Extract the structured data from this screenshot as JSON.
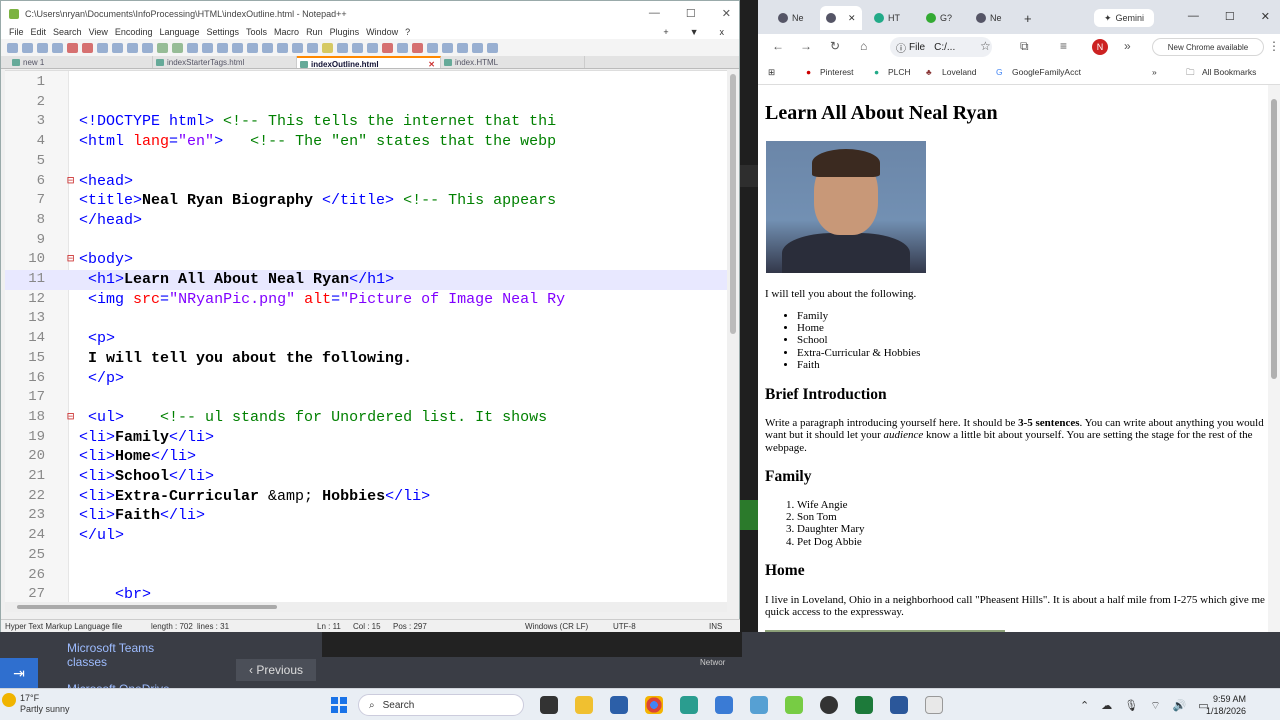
{
  "npp": {
    "title": "C:\\Users\\nryan\\Documents\\InfoProcessing\\HTML\\indexOutline.html - Notepad++",
    "menu": [
      "File",
      "Edit",
      "Search",
      "View",
      "Encoding",
      "Language",
      "Settings",
      "Tools",
      "Macro",
      "Run",
      "Plugins",
      "Window",
      "?"
    ],
    "menu_right": [
      "+",
      "▼",
      "x"
    ],
    "tabs": [
      {
        "label": "new 1"
      },
      {
        "label": "indexStarterTags.html"
      },
      {
        "label": "indexOutline.html"
      },
      {
        "label": "index.HTML"
      }
    ],
    "lines": [
      {
        "n": "1",
        "parts": []
      },
      {
        "n": "2",
        "parts": []
      },
      {
        "n": "3",
        "parts": [
          {
            "c": "tag",
            "t": "<!DOCTYPE html>"
          },
          {
            "c": "cmt",
            "t": " <!-- This tells the internet that thi"
          }
        ]
      },
      {
        "n": "4",
        "parts": [
          {
            "c": "tag",
            "t": "<html "
          },
          {
            "c": "attr",
            "t": "lang"
          },
          {
            "c": "tag",
            "t": "="
          },
          {
            "c": "str",
            "t": "\"en\""
          },
          {
            "c": "tag",
            "t": ">"
          },
          {
            "c": "cmt",
            "t": "   <!-- The \"en\" states that the webp"
          }
        ]
      },
      {
        "n": "5",
        "parts": []
      },
      {
        "n": "6",
        "fold": "⊟",
        "parts": [
          {
            "c": "tag",
            "t": "<head>"
          }
        ]
      },
      {
        "n": "7",
        "parts": [
          {
            "c": "tag",
            "t": "<title>"
          },
          {
            "c": "txt",
            "t": "Neal Ryan Biography "
          },
          {
            "c": "tag",
            "t": "</title>"
          },
          {
            "c": "cmt",
            "t": " <!-- This appears"
          }
        ]
      },
      {
        "n": "8",
        "parts": [
          {
            "c": "tag",
            "t": "</head>"
          }
        ]
      },
      {
        "n": "9",
        "parts": []
      },
      {
        "n": "10",
        "fold": "⊟",
        "parts": [
          {
            "c": "tag",
            "t": "<body>"
          }
        ]
      },
      {
        "n": "11",
        "cur": true,
        "parts": [
          {
            "c": "ent",
            "t": " "
          },
          {
            "c": "tag",
            "t": "<h1>"
          },
          {
            "c": "txt",
            "t": "Learn All About Neal Ryan"
          },
          {
            "c": "tag",
            "t": "</h1>"
          }
        ]
      },
      {
        "n": "12",
        "parts": [
          {
            "c": "ent",
            "t": " "
          },
          {
            "c": "tag",
            "t": "<img "
          },
          {
            "c": "attr",
            "t": "src"
          },
          {
            "c": "tag",
            "t": "="
          },
          {
            "c": "str",
            "t": "\"NRyanPic.png\""
          },
          {
            "c": "attr",
            "t": " alt"
          },
          {
            "c": "tag",
            "t": "="
          },
          {
            "c": "str",
            "t": "\"Picture of Image Neal Ry"
          }
        ]
      },
      {
        "n": "13",
        "parts": []
      },
      {
        "n": "14",
        "parts": [
          {
            "c": "ent",
            "t": " "
          },
          {
            "c": "tag",
            "t": "<p>"
          }
        ]
      },
      {
        "n": "15",
        "parts": [
          {
            "c": "txt",
            "t": " I will tell you about the following."
          }
        ]
      },
      {
        "n": "16",
        "parts": [
          {
            "c": "ent",
            "t": " "
          },
          {
            "c": "tag",
            "t": "</p>"
          }
        ]
      },
      {
        "n": "17",
        "parts": []
      },
      {
        "n": "18",
        "fold": "⊟",
        "parts": [
          {
            "c": "ent",
            "t": " "
          },
          {
            "c": "tag",
            "t": "<ul>"
          },
          {
            "c": "cmt",
            "t": "    <!-- ul stands for Unordered list. It shows"
          }
        ]
      },
      {
        "n": "19",
        "parts": [
          {
            "c": "tag",
            "t": "<li>"
          },
          {
            "c": "txt",
            "t": "Family"
          },
          {
            "c": "tag",
            "t": "</li>"
          }
        ]
      },
      {
        "n": "20",
        "parts": [
          {
            "c": "tag",
            "t": "<li>"
          },
          {
            "c": "txt",
            "t": "Home"
          },
          {
            "c": "tag",
            "t": "</li>"
          }
        ]
      },
      {
        "n": "21",
        "parts": [
          {
            "c": "tag",
            "t": "<li>"
          },
          {
            "c": "txt",
            "t": "School"
          },
          {
            "c": "tag",
            "t": "</li>"
          }
        ]
      },
      {
        "n": "22",
        "parts": [
          {
            "c": "tag",
            "t": "<li>"
          },
          {
            "c": "txt",
            "t": "Extra-Curricular "
          },
          {
            "c": "ent",
            "t": "&amp;"
          },
          {
            "c": "txt",
            "t": " Hobbies"
          },
          {
            "c": "tag",
            "t": "</li>"
          }
        ]
      },
      {
        "n": "23",
        "parts": [
          {
            "c": "tag",
            "t": "<li>"
          },
          {
            "c": "txt",
            "t": "Faith"
          },
          {
            "c": "tag",
            "t": "</li>"
          }
        ]
      },
      {
        "n": "24",
        "parts": [
          {
            "c": "tag",
            "t": "</ul>"
          }
        ]
      },
      {
        "n": "25",
        "parts": []
      },
      {
        "n": "26",
        "parts": []
      },
      {
        "n": "27",
        "parts": [
          {
            "c": "ent",
            "t": "    "
          },
          {
            "c": "tag",
            "t": "<br>"
          }
        ]
      }
    ],
    "status": {
      "type": "Hyper Text Markup Language file",
      "length": "length : 702",
      "lines": "lines : 31",
      "ln": "Ln : 11",
      "col": "Col : 15",
      "pos": "Pos : 297",
      "eol": "Windows (CR LF)",
      "enc": "UTF-8",
      "ins": "INS"
    }
  },
  "chrome": {
    "tabs": [
      {
        "label": "Ne"
      },
      {
        "label": "HT"
      },
      {
        "label": "G?"
      },
      {
        "label": "Ne"
      },
      {
        "label": "Gemini"
      }
    ],
    "omnibox_label": "File",
    "omnibox_text": "C:/...",
    "profile": "N",
    "new_chrome": "New Chrome available",
    "bookmarks": [
      "Pinterest",
      "PLCH",
      "Loveland",
      "GoogleFamilyAcct"
    ],
    "all_bookmarks": "All Bookmarks",
    "page": {
      "h1": "Learn All About Neal Ryan",
      "intro": "I will tell you about the following.",
      "topics": [
        "Family",
        "Home",
        "School",
        "Extra-Curricular & Hobbies",
        "Faith"
      ],
      "h2_intro": "Brief Introduction",
      "intro_p_a": "Write a paragraph introducing yourself here. It should be ",
      "intro_p_b": "3-5 sentences",
      "intro_p_c": ". You can write about anything you would want but it should let your ",
      "intro_p_d": "audience",
      "intro_p_e": " know a little bit about yourself. You are setting the stage for the rest of the webpage.",
      "h2_family": "Family",
      "family": [
        "Wife Angie",
        "Son Tom",
        "Daughter Mary",
        "Pet Dog Abbie"
      ],
      "h2_home": "Home",
      "home_p": "I live in Loveland, Ohio in a neighborhood call \"Pheasent Hills\". It is about a half mile from I-275 which give me quick access to the expressway."
    }
  },
  "behind": {
    "teams": "Microsoft Teams classes",
    "onedrive": "Microsoft OneDrive",
    "prev": "‹ Previous",
    "network": "Networ"
  },
  "taskbar": {
    "temp": "17°F",
    "weather": "Partly sunny",
    "search": "Search",
    "time": "9:59 AM",
    "date": "1/18/2026"
  }
}
